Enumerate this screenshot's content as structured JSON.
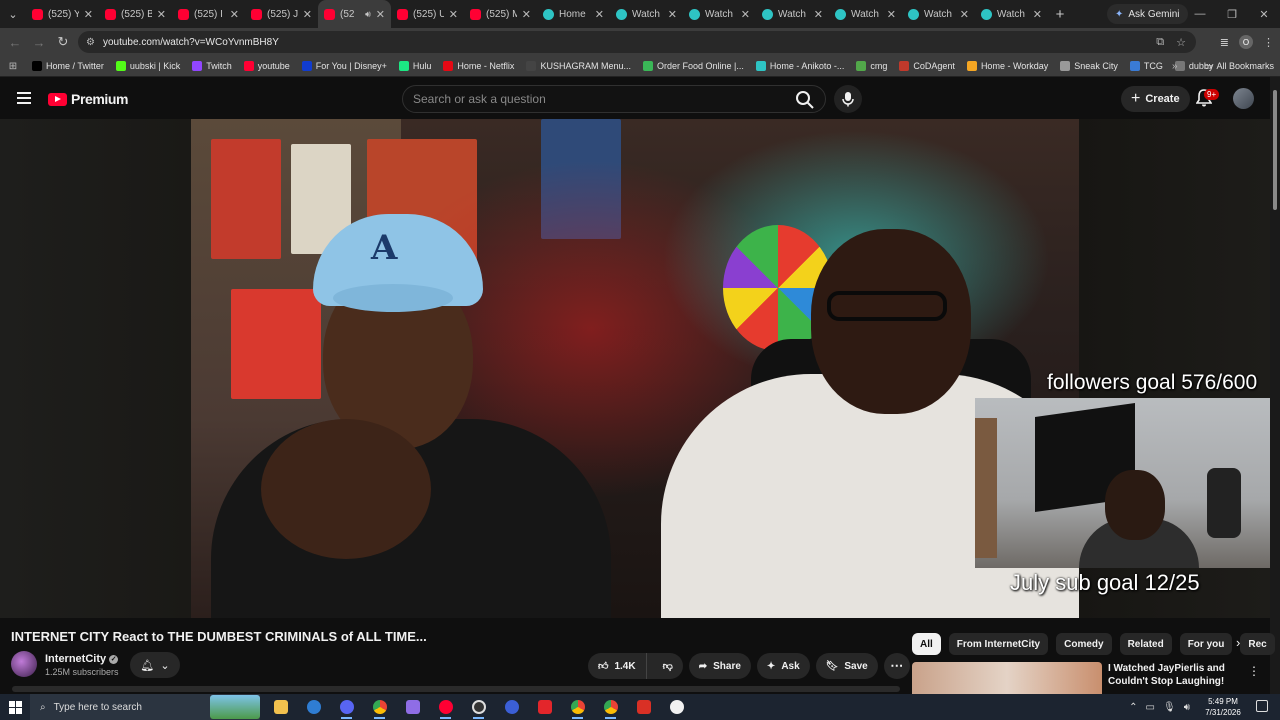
{
  "browser": {
    "tabs": [
      {
        "title": "(525) Y",
        "favicon": "youtube-icon"
      },
      {
        "title": "(525) B",
        "favicon": "youtube-icon"
      },
      {
        "title": "(525) I",
        "favicon": "youtube-icon"
      },
      {
        "title": "(525) J",
        "favicon": "youtube-icon"
      },
      {
        "title": "(52",
        "favicon": "youtube-icon",
        "active": true,
        "audio": true
      },
      {
        "title": "(525) U",
        "favicon": "youtube-icon"
      },
      {
        "title": "(525) M",
        "favicon": "youtube-icon"
      },
      {
        "title": "Home",
        "favicon": "globe-icon"
      },
      {
        "title": "Watch",
        "favicon": "globe-icon"
      },
      {
        "title": "Watch",
        "favicon": "globe-icon"
      },
      {
        "title": "Watch",
        "favicon": "globe-icon"
      },
      {
        "title": "Watch",
        "favicon": "globe-icon"
      },
      {
        "title": "Watch",
        "favicon": "globe-icon"
      },
      {
        "title": "Watch",
        "favicon": "globe-icon"
      }
    ],
    "ask_gemini": "Ask Gemini",
    "url": "youtube.com/watch?v=WCoYvnmBH8Y",
    "profile_letter": "O",
    "bookmarks": [
      {
        "label": "Home / Twitter",
        "color": "#000000"
      },
      {
        "label": "uubski | Kick",
        "color": "#53fc18"
      },
      {
        "label": "Twitch",
        "color": "#9146ff"
      },
      {
        "label": "youtube",
        "color": "#ff0033"
      },
      {
        "label": "For You | Disney+",
        "color": "#113ccf"
      },
      {
        "label": "Hulu",
        "color": "#1ce783"
      },
      {
        "label": "Home - Netflix",
        "color": "#e50914"
      },
      {
        "label": "KUSHAGRAM Menu...",
        "color": "#444444"
      },
      {
        "label": "Order Food Online |...",
        "color": "#3ab757"
      },
      {
        "label": "Home - Anikoto -...",
        "color": "#2ec4c4"
      },
      {
        "label": "cmg",
        "color": "#52a84a"
      },
      {
        "label": "CoDAgent",
        "color": "#c0392b"
      },
      {
        "label": "Home - Workday",
        "color": "#f5a623"
      },
      {
        "label": "Sneak City",
        "color": "#999999"
      },
      {
        "label": "TCG",
        "color": "#3a7bd5"
      },
      {
        "label": "dubby",
        "color": "#777777"
      }
    ],
    "all_bookmarks": "All Bookmarks"
  },
  "youtube": {
    "logo_word": "Premium",
    "search_placeholder": "Search or ask a question",
    "create_label": "Create",
    "notification_count": "9+"
  },
  "overlay": {
    "followers_goal": "followers goal 576/600",
    "sub_goal": "July sub goal 12/25"
  },
  "video": {
    "title": "INTERNET CITY React to THE DUMBEST CRIMINALS of ALL TIME...",
    "channel": "InternetCity",
    "subscribers": "1.25M subscribers",
    "likes": "1.4K",
    "share": "Share",
    "ask": "Ask",
    "save": "Save"
  },
  "chips": [
    "All",
    "From InternetCity",
    "Comedy",
    "Related",
    "For you",
    "Rec"
  ],
  "recommendation": {
    "title": "I Watched JayPierlis and Couldn't Stop Laughing!"
  },
  "taskbar": {
    "search_placeholder": "Type here to search",
    "time": "5:49 PM",
    "date": "7/31/2026"
  },
  "colors": {
    "youtube_red": "#ff0033",
    "bg": "#0f0f0f",
    "chip_selected": "#f1f1f1"
  }
}
